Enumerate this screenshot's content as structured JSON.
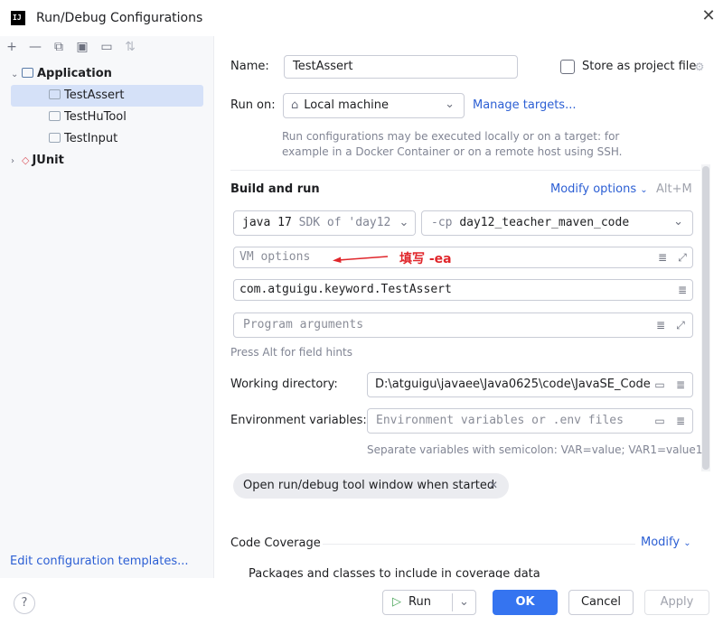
{
  "window": {
    "title": "Run/Debug Configurations",
    "logo": "IJ"
  },
  "toolbar_icons": [
    "add-icon",
    "remove-icon",
    "copy-icon",
    "save-icon",
    "new-folder-icon",
    "sort-icon"
  ],
  "tree": {
    "application": "Application",
    "children": [
      "TestAssert",
      "TestHuTool",
      "TestInput"
    ],
    "junit": "JUnit"
  },
  "left_footer": {
    "templates_link": "Edit configuration templates..."
  },
  "form": {
    "name_label": "Name:",
    "name_value": "TestAssert",
    "store_label": "Store as project file",
    "run_on_label": "Run on:",
    "run_on_value": "Local machine",
    "manage_targets": "Manage targets...",
    "run_on_hint_1": "Run configurations may be executed locally or on a target: for",
    "run_on_hint_2": "example in a Docker Container or on a remote host using SSH.",
    "build_run_title": "Build and run",
    "modify_options": "Modify options",
    "modify_shortcut": "Alt+M",
    "sdk_main": "java 17",
    "sdk_detail": "SDK of 'day12",
    "cp_prefix": "-cp",
    "cp_value": "day12_teacher_maven_code",
    "vm_placeholder": "VM options",
    "annotation": "填写 -ea",
    "main_class": "com.atguigu.keyword.TestAssert",
    "program_args_placeholder": "Program arguments",
    "alt_hint": "Press Alt for field hints",
    "working_dir_label": "Working directory:",
    "working_dir_value": "D:\\atguigu\\javaee\\Java0625\\code\\JavaSE_Code",
    "env_label": "Environment variables:",
    "env_placeholder": "Environment variables or .env files",
    "env_hint": "Separate variables with semicolon: VAR=value; VAR1=value1",
    "chip_label": "Open run/debug tool window when started",
    "coverage_title": "Code Coverage",
    "coverage_modify": "Modify",
    "coverage_packages": "Packages and classes to include in coverage data"
  },
  "footer": {
    "help": "?",
    "run": "Run",
    "ok": "OK",
    "cancel": "Cancel",
    "apply": "Apply"
  },
  "colors": {
    "accent": "#3574f0",
    "link": "#2c5fd4",
    "annotation": "#e0262b"
  }
}
